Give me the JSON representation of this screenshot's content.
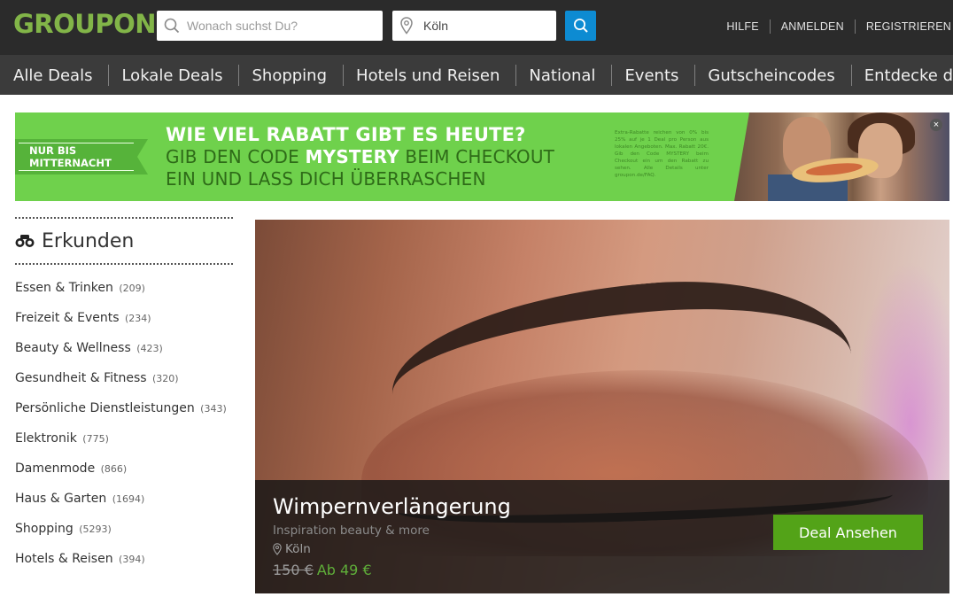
{
  "header": {
    "logo": "GROUPON",
    "search": {
      "placeholder": "Wonach suchst Du?",
      "value": ""
    },
    "location": {
      "value": "Köln"
    },
    "links": [
      "HILFE",
      "ANMELDEN",
      "REGISTRIEREN"
    ]
  },
  "nav": {
    "items": [
      "Alle Deals",
      "Lokale Deals",
      "Shopping",
      "Hotels und Reisen",
      "National",
      "Events",
      "Gutscheincodes",
      "Entdecke den Frühling"
    ]
  },
  "banner": {
    "ribbon_line1": "NUR BIS",
    "ribbon_line2": "MITTERNACHT",
    "headline": "WIE VIEL RABATT GIBT ES HEUTE?",
    "line2_prefix": "GIB DEN CODE ",
    "code": "MYSTERY",
    "line2_suffix": " BEIM CHECKOUT",
    "line3": "EIN UND LASS DICH ÜBERRASCHEN",
    "fine_print": "Extra-Rabatte reichen von 0% bis 25% auf je 1 Deal pro Person aus lokalen Angeboten. Max. Rabatt 20€. Gib den Code MYSTERY beim Checkout ein um den Rabatt zu sehen. Alle Details unter groupon.de/FAQ.",
    "close_label": "×"
  },
  "sidebar": {
    "title": "Erkunden",
    "categories": [
      {
        "label": "Essen & Trinken",
        "count": "(209)"
      },
      {
        "label": "Freizeit & Events",
        "count": "(234)"
      },
      {
        "label": "Beauty & Wellness",
        "count": "(423)"
      },
      {
        "label": "Gesundheit & Fitness",
        "count": "(320)"
      },
      {
        "label": "Persönliche Dienstleistungen",
        "count": "(343)"
      },
      {
        "label": "Elektronik",
        "count": "(775)"
      },
      {
        "label": "Damenmode",
        "count": "(866)"
      },
      {
        "label": "Haus & Garten",
        "count": "(1694)"
      },
      {
        "label": "Shopping",
        "count": "(5293)"
      },
      {
        "label": "Hotels & Reisen",
        "count": "(394)"
      }
    ]
  },
  "deal": {
    "title": "Wimpernverlängerung",
    "merchant": "Inspiration beauty & more",
    "location": "Köln",
    "old_price": "150 €",
    "new_price": "Ab 49 €",
    "button": "Deal Ansehen"
  },
  "colors": {
    "brand_green": "#82b548",
    "header_bg": "#2b2b2b",
    "nav_bg": "#3b3b3b",
    "search_button": "#0d8bd2",
    "banner_green": "#6fd14c",
    "deal_button": "#53a318"
  },
  "icons": {
    "search": "magnifier-icon",
    "location": "map-pin-icon",
    "explore": "binoculars-icon",
    "close": "close-icon"
  }
}
